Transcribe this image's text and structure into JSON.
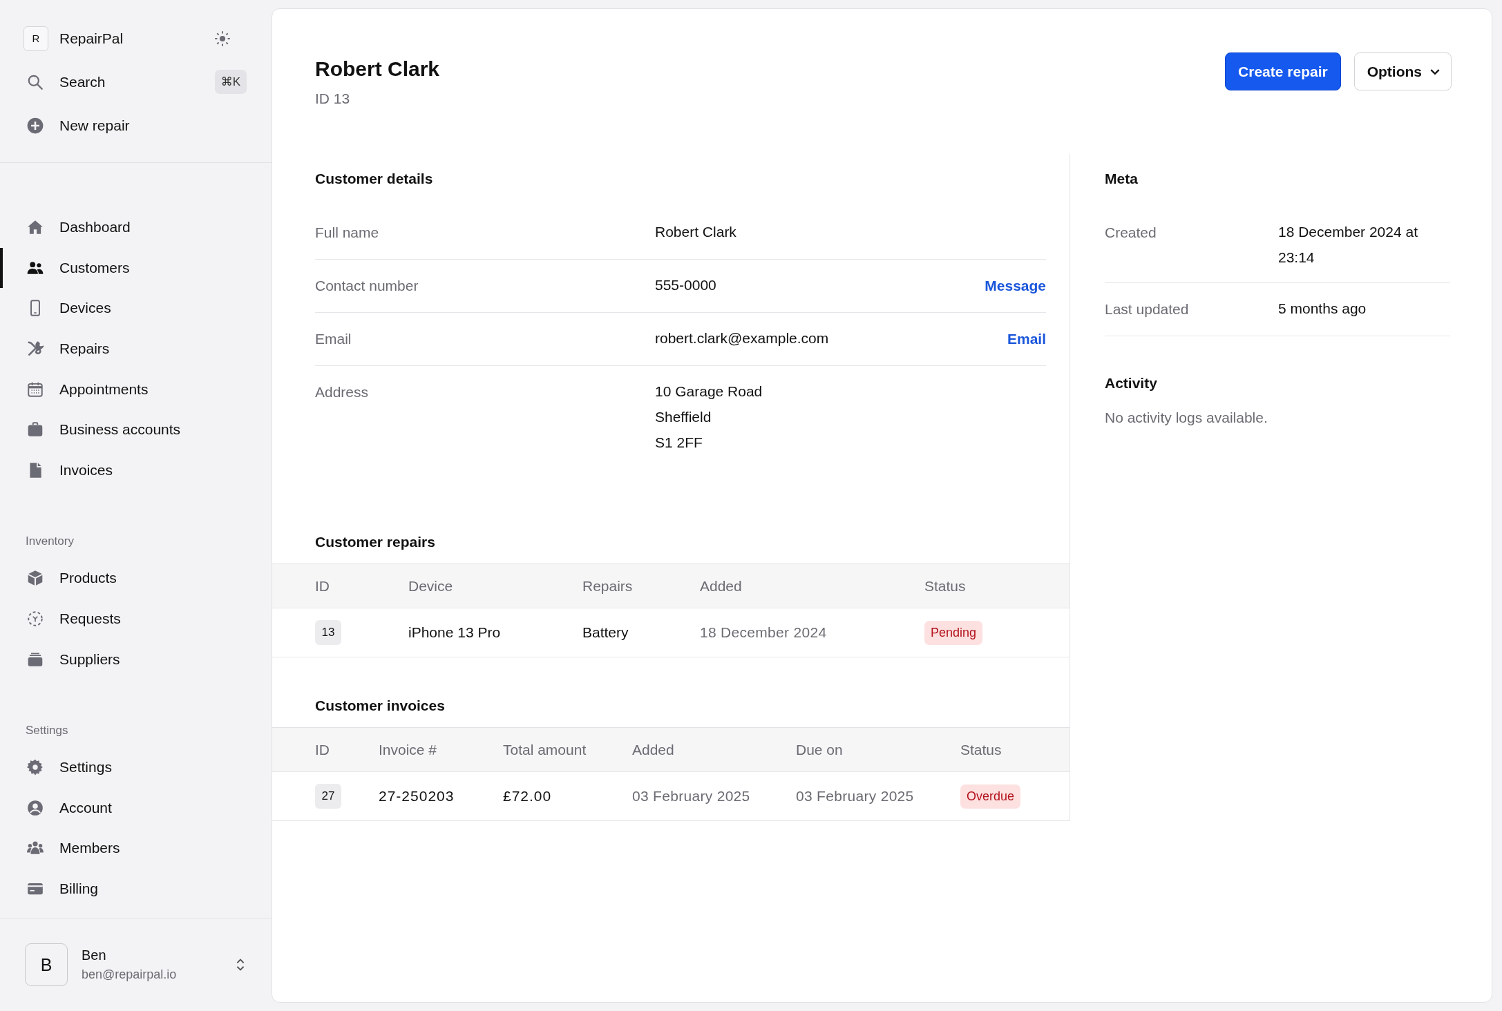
{
  "sidebar": {
    "brand": {
      "logo_letter": "R",
      "name": "RepairPal"
    },
    "search": {
      "label": "Search",
      "shortcut": "⌘K"
    },
    "new_repair": "New repair",
    "groups": [
      {
        "items": [
          {
            "label": "Dashboard",
            "selected": false
          },
          {
            "label": "Customers",
            "selected": true
          },
          {
            "label": "Devices",
            "selected": false
          },
          {
            "label": "Repairs",
            "selected": false
          },
          {
            "label": "Appointments",
            "selected": false
          },
          {
            "label": "Business accounts",
            "selected": false
          },
          {
            "label": "Invoices",
            "selected": false
          }
        ]
      },
      {
        "heading": "Inventory",
        "items": [
          {
            "label": "Products",
            "selected": false
          },
          {
            "label": "Requests",
            "selected": false
          },
          {
            "label": "Suppliers",
            "selected": false
          }
        ]
      },
      {
        "heading": "Settings",
        "items": [
          {
            "label": "Settings",
            "selected": false
          },
          {
            "label": "Account",
            "selected": false
          },
          {
            "label": "Members",
            "selected": false
          },
          {
            "label": "Billing",
            "selected": false
          }
        ]
      }
    ],
    "user": {
      "avatar_letter": "B",
      "name": "Ben",
      "email": "ben@repairpal.io"
    }
  },
  "header": {
    "title": "Robert Clark",
    "subtitle": "ID 13",
    "actions": [
      {
        "label": "Create repair",
        "kind": "primary"
      },
      {
        "label": "Options",
        "kind": "dropdown"
      }
    ]
  },
  "customer_details": {
    "heading": "Customer details",
    "rows": [
      {
        "label": "Full name",
        "value": [
          "Robert Clark"
        ]
      },
      {
        "label": "Contact number",
        "value": [
          "555-0000"
        ],
        "action": "Message"
      },
      {
        "label": "Email",
        "value": [
          "robert.clark@example.com"
        ],
        "action": "Email"
      },
      {
        "label": "Address",
        "value": [
          "10 Garage Road",
          "Sheffield",
          "S1 2FF"
        ]
      }
    ]
  },
  "customer_repairs": {
    "heading": "Customer repairs",
    "columns": [
      "ID",
      "Device",
      "Repairs",
      "Added",
      "Status"
    ],
    "rows": [
      {
        "cells": [
          {
            "kind": "id",
            "text": "13"
          },
          {
            "kind": "text",
            "text": "iPhone 13 Pro"
          },
          {
            "kind": "text",
            "text": "Battery"
          },
          {
            "kind": "muted",
            "text": "18 December 2024"
          },
          {
            "kind": "status",
            "text": "Pending"
          }
        ]
      }
    ]
  },
  "customer_invoices": {
    "heading": "Customer invoices",
    "columns": [
      "ID",
      "Invoice #",
      "Total amount",
      "Added",
      "Due on",
      "Status"
    ],
    "rows": [
      {
        "cells": [
          {
            "kind": "id",
            "text": "27"
          },
          {
            "kind": "mono",
            "text": "27-250203"
          },
          {
            "kind": "mono",
            "text": "£72.00"
          },
          {
            "kind": "muted",
            "text": "03 February 2025"
          },
          {
            "kind": "muted",
            "text": "03 February 2025"
          },
          {
            "kind": "status",
            "text": "Overdue"
          }
        ]
      }
    ]
  },
  "meta": {
    "heading": "Meta",
    "rows": [
      {
        "label": "Created",
        "value": "18 December 2024 at 23:14"
      },
      {
        "label": "Last updated",
        "value": "5 months ago"
      }
    ]
  },
  "activity": {
    "heading": "Activity",
    "empty_text": "No activity logs available."
  }
}
